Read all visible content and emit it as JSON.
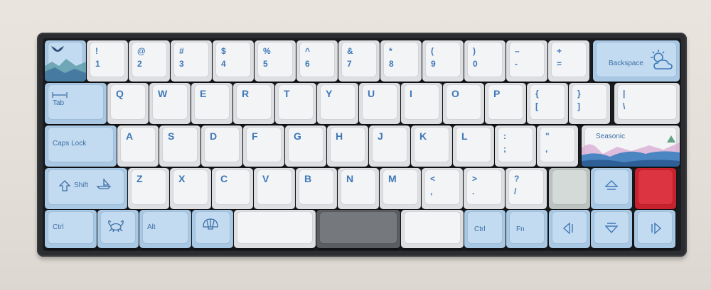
{
  "image": {
    "subject": "mechanical-keyboard",
    "colors": {
      "case": "#2c2d30",
      "accent_blue": "#3e78b8",
      "mod_blue": "#a9c8e4",
      "alpha_white": "#f3f4f6",
      "red": "#c8222e"
    }
  },
  "legends": {
    "num_row": [
      {
        "top": "!",
        "bottom": "1"
      },
      {
        "top": "@",
        "bottom": "2"
      },
      {
        "top": "#",
        "bottom": "3"
      },
      {
        "top": "$",
        "bottom": "4"
      },
      {
        "top": "%",
        "bottom": "5"
      },
      {
        "top": "^",
        "bottom": "6"
      },
      {
        "top": "&",
        "bottom": "7"
      },
      {
        "top": "*",
        "bottom": "8"
      },
      {
        "top": "(",
        "bottom": "9"
      },
      {
        "top": ")",
        "bottom": "0"
      },
      {
        "top": "–",
        "bottom": "-"
      },
      {
        "top": "+",
        "bottom": "="
      }
    ],
    "backspace": "Backspace",
    "tab": "Tab",
    "qwerty": [
      "Q",
      "W",
      "E",
      "R",
      "T",
      "Y",
      "U",
      "I",
      "O",
      "P"
    ],
    "bracket_l": {
      "top": "{",
      "bottom": "["
    },
    "bracket_r": {
      "top": "}",
      "bottom": "]"
    },
    "backslash": {
      "top": "|",
      "bottom": "\\"
    },
    "caps": "Caps Lock",
    "asdf": [
      "A",
      "S",
      "D",
      "F",
      "G",
      "H",
      "J",
      "K",
      "L"
    ],
    "semicolon": {
      "top": ":",
      "bottom": ";"
    },
    "quote": {
      "top": "\"",
      "bottom": ","
    },
    "enter": "Seasonic",
    "shift": "Shift",
    "zxcv": [
      "Z",
      "X",
      "C",
      "V",
      "B",
      "N",
      "M"
    ],
    "comma": {
      "top": "<",
      "bottom": ","
    },
    "period": {
      "top": ">",
      "bottom": "."
    },
    "slash": {
      "top": "?",
      "bottom": "/"
    },
    "ctrl_l": "Ctrl",
    "alt": "Alt",
    "ctrl_r": "Ctrl",
    "fn": "Fn"
  },
  "icons": [
    "whale-tail-icon",
    "sun-cloud-icon",
    "boat-icon",
    "crab-icon",
    "shell-icon",
    "up-arrow-icon",
    "left-arrow-icon",
    "down-arrow-icon",
    "right-arrow-icon"
  ]
}
